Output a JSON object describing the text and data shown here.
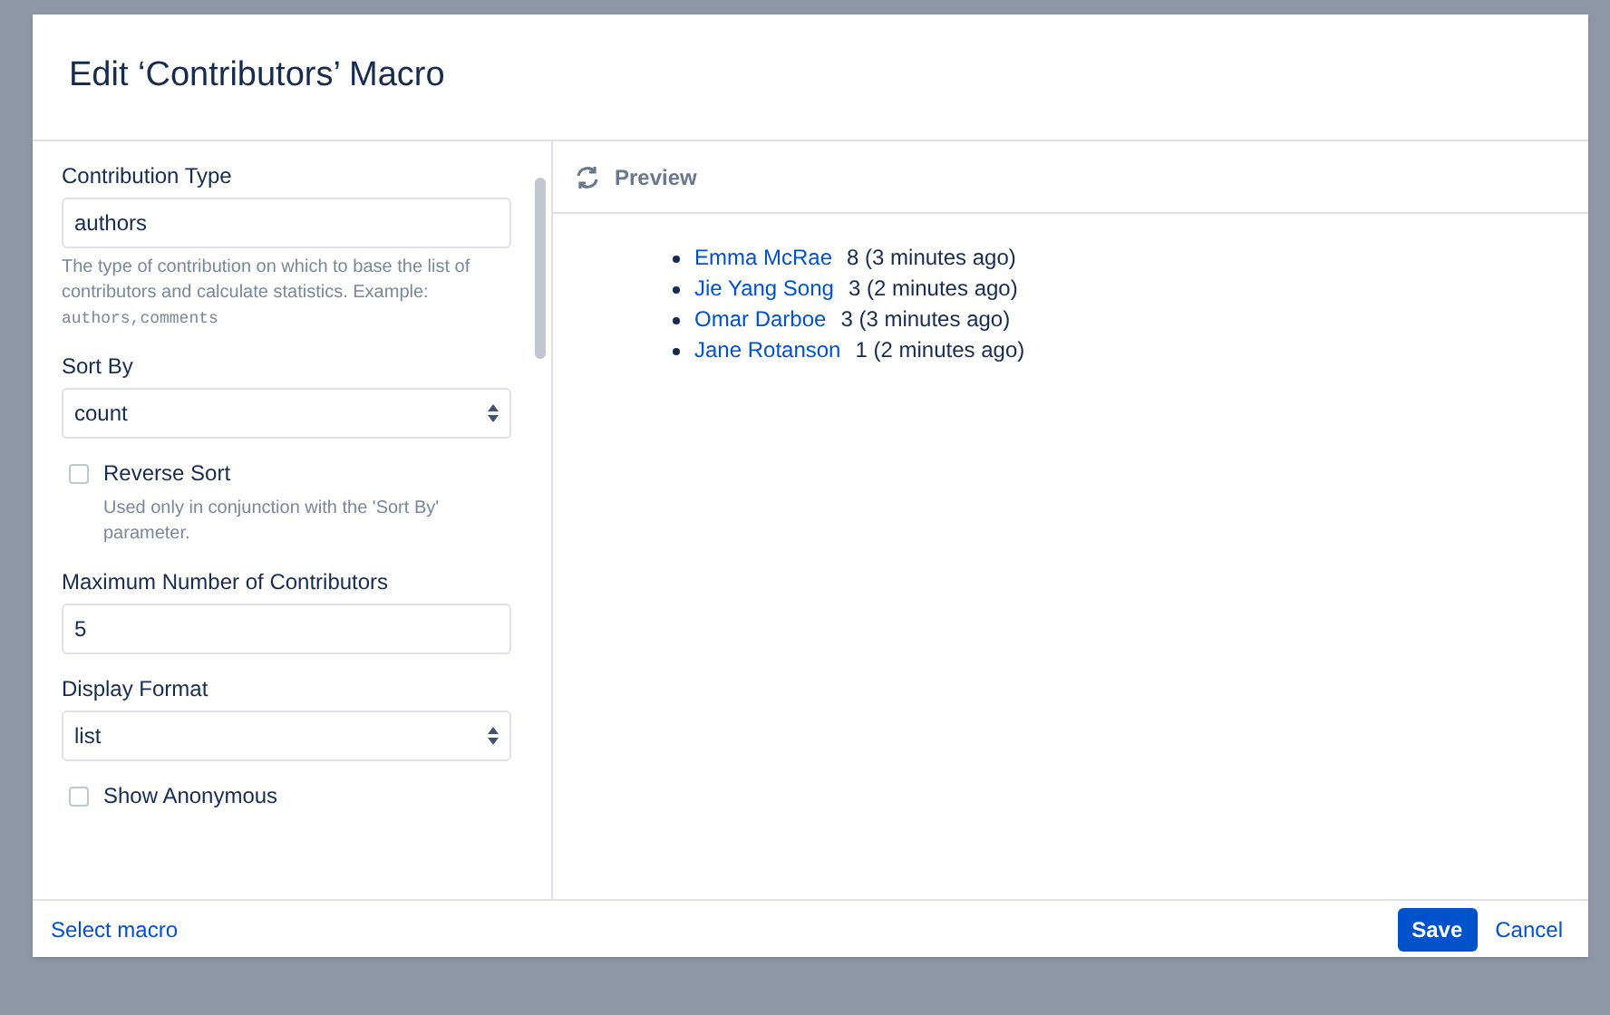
{
  "dialog": {
    "title": "Edit ‘Contributors’ Macro"
  },
  "fields": [
    {
      "kind": "text",
      "label": "Contribution Type",
      "value": "authors",
      "help": "The type of contribution on which to base the list of contributors and calculate statistics. Example:",
      "help_code": "authors,comments"
    },
    {
      "kind": "select",
      "label": "Sort By",
      "value": "count"
    },
    {
      "kind": "checkbox",
      "label": "Reverse Sort",
      "checked": false,
      "help": "Used only in conjunction with the 'Sort By' parameter."
    },
    {
      "kind": "text",
      "label": "Maximum Number of Contributors",
      "value": "5"
    },
    {
      "kind": "select",
      "label": "Display Format",
      "value": "list"
    },
    {
      "kind": "checkbox",
      "label": "Show Anonymous",
      "checked": false
    }
  ],
  "preview": {
    "title": "Preview",
    "items": [
      {
        "name": "Emma McRae",
        "detail": "8 (3 minutes ago)"
      },
      {
        "name": "Jie Yang Song",
        "detail": "3 (2 minutes ago)"
      },
      {
        "name": "Omar Darboe",
        "detail": "3 (3 minutes ago)"
      },
      {
        "name": "Jane Rotanson",
        "detail": "1 (2 minutes ago)"
      }
    ]
  },
  "footer": {
    "link": "Select macro",
    "buttons": [
      {
        "kind": "primary",
        "label": "Save"
      },
      {
        "kind": "link",
        "label": "Cancel"
      }
    ]
  }
}
